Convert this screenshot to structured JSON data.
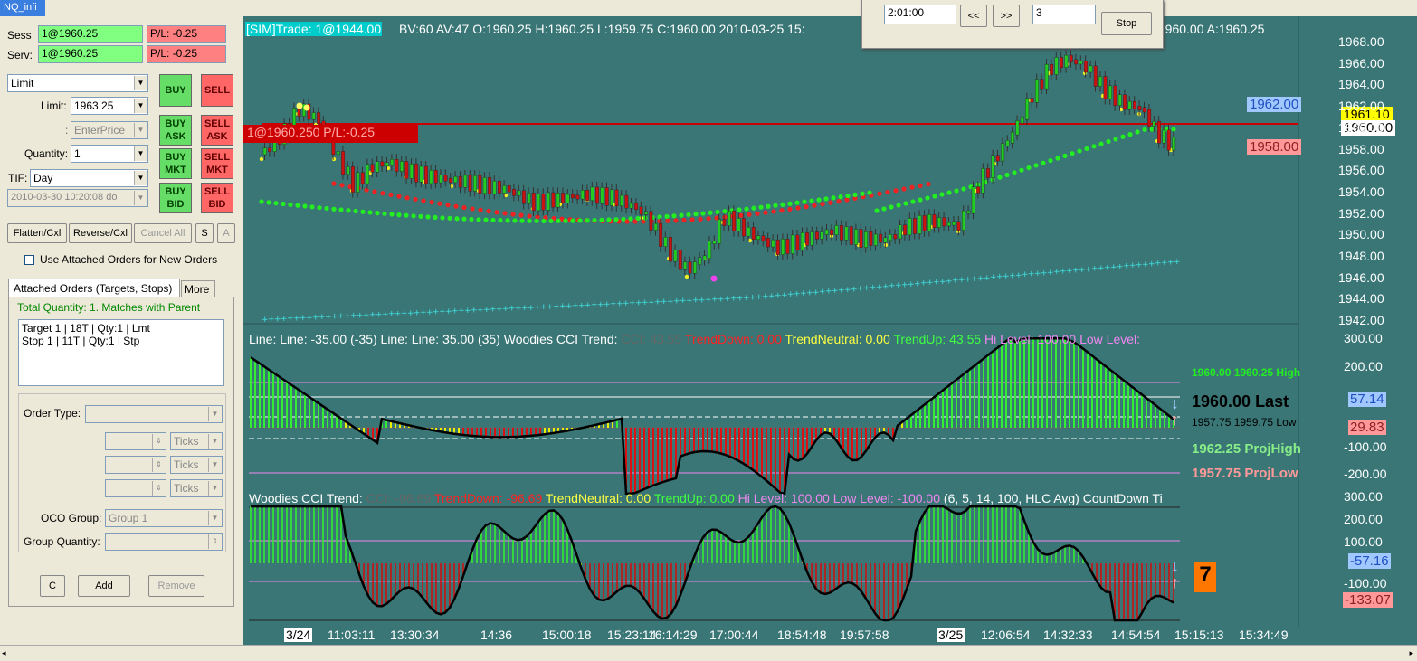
{
  "window_tab": "NQ_infi",
  "order_panel": {
    "sess_label": "Sess",
    "sess_value": "1@1960.25",
    "sess_pl": "P/L: -0.25",
    "serv_label": "Serv:",
    "serv_value": "1@1960.25",
    "serv_pl": "P/L: -0.25",
    "order_type": "Limit",
    "limit_label": "Limit:",
    "limit_value": "1963.25",
    "enterprice_prefix": ":",
    "enterprice": "EnterPrice",
    "quantity_label": "Quantity:",
    "quantity_value": "1",
    "tif_label": "TIF:",
    "tif_value": "Day",
    "date_value": "2010-03-30 10:20:08 do",
    "buy": "BUY",
    "sell": "SELL",
    "buy_ask": "BUY ASK",
    "sell_ask": "SELL ASK",
    "buy_mkt": "BUY MKT",
    "sell_mkt": "SELL MKT",
    "buy_bid": "BUY BID",
    "sell_bid": "SELL BID",
    "flatten": "Flatten/Cxl",
    "reverse": "Reverse/Cxl",
    "cancel_all": "Cancel All",
    "s": "S",
    "a": "A",
    "use_attached": "Use Attached Orders for New Orders",
    "tab_attached": "Attached Orders (Targets, Stops)",
    "tab_more": "More",
    "total_quantity": "Total Quantity: 1. Matches with Parent",
    "orders": [
      "Target 1 | 18T | Qty:1 | Lmt",
      "Stop 1 | 11T | Qty:1 | Stp"
    ],
    "order_type_label": "Order Type:",
    "ticks1": "Ticks",
    "ticks2": "Ticks",
    "ticks3": "Ticks",
    "oco_label": "OCO Group:",
    "oco_value": "Group 1",
    "group_qty_label": "Group Quantity:",
    "c": "C",
    "add": "Add",
    "remove": "Remove"
  },
  "replay": {
    "time": "2:01:00",
    "rew": "<<",
    "ff": ">>",
    "speed": "3",
    "stop": "Stop"
  },
  "chart": {
    "sim_tag": "[SIM]Trade: 1@1944.00",
    "header": "BV:60 AV:47 O:1960.25 H:1960.25 L:1959.75 C:1960.00 2010-03-25 15:",
    "header_right": ":1960.00 A:1960.25",
    "position_label": "1@1960.250 P/L:-0.25",
    "price_axis": [
      "1968.00",
      "1966.00",
      "1964.00",
      "1962.00",
      "1960.00",
      "1958.00",
      "1956.00",
      "1954.00",
      "1952.00",
      "1950.00",
      "1948.00",
      "1946.00",
      "1944.00",
      "1942.00"
    ],
    "price_tag_blue": "1962.00",
    "price_tag_pink": "1958.00",
    "price_tag_yellow": "1961.10",
    "price_tag_white": "1960.00",
    "p1_line": "Line:  Line: -35.00   (-35)   Line:  Line: 35.00   (35)   Woodies CCI Trend:",
    "p1_cci": "CCI: 43.55",
    "p1_down": "TrendDown: 0.00",
    "p1_neutral": "TrendNeutral: 0.00",
    "p1_up": "TrendUp: 43.55",
    "p1_hi": "Hi Level: 100.00",
    "p1_lo": "Low Level:",
    "p1_axis": [
      "300.00",
      "200.00",
      "-100.00",
      "-200.00"
    ],
    "p1_hi_info": "1960.00 1960.25 High",
    "p1_last": "1960.00 Last",
    "p1_low_info": "1957.75 1959.75 Low",
    "p1_projhigh": "1962.25 ProjHigh",
    "p1_projlow": "1957.75 ProjLow",
    "p1_tag_blue": "57.14",
    "p1_tag_pink": "29.83",
    "p2_title": "Woodies CCI Trend:",
    "p2_cci": "CCI: -96.69",
    "p2_down": "TrendDown: -96.69",
    "p2_neutral": "TrendNeutral: 0.00",
    "p2_up": "TrendUp: 0.00",
    "p2_hi": "Hi Level: 100.00",
    "p2_lo": "Low Level: -100.00",
    "p2_params": "(6, 5, 14, 100, HLC Avg)",
    "p2_countdown": "CountDown Ti",
    "p2_axis": [
      "300.00",
      "200.00",
      "100.00",
      "-100.00"
    ],
    "p2_tag_blue": "-57.16",
    "p2_tag_pink": "-133.07",
    "countdown": "7",
    "time_axis": [
      "3/24",
      "11:03:11",
      "13:30:34",
      "14:36",
      "15:00:18",
      "15:23:14",
      "16:14:29",
      "17:00:44",
      "18:54:48",
      "19:57:58",
      "3/25",
      "12:06:54",
      "14:32:33",
      "14:54:54",
      "15:15:13",
      "15:34:49"
    ],
    "colors": {
      "bg": "#3a7676",
      "up": "#22cc22",
      "down": "#cc1111",
      "neutral": "#eeee00"
    }
  }
}
